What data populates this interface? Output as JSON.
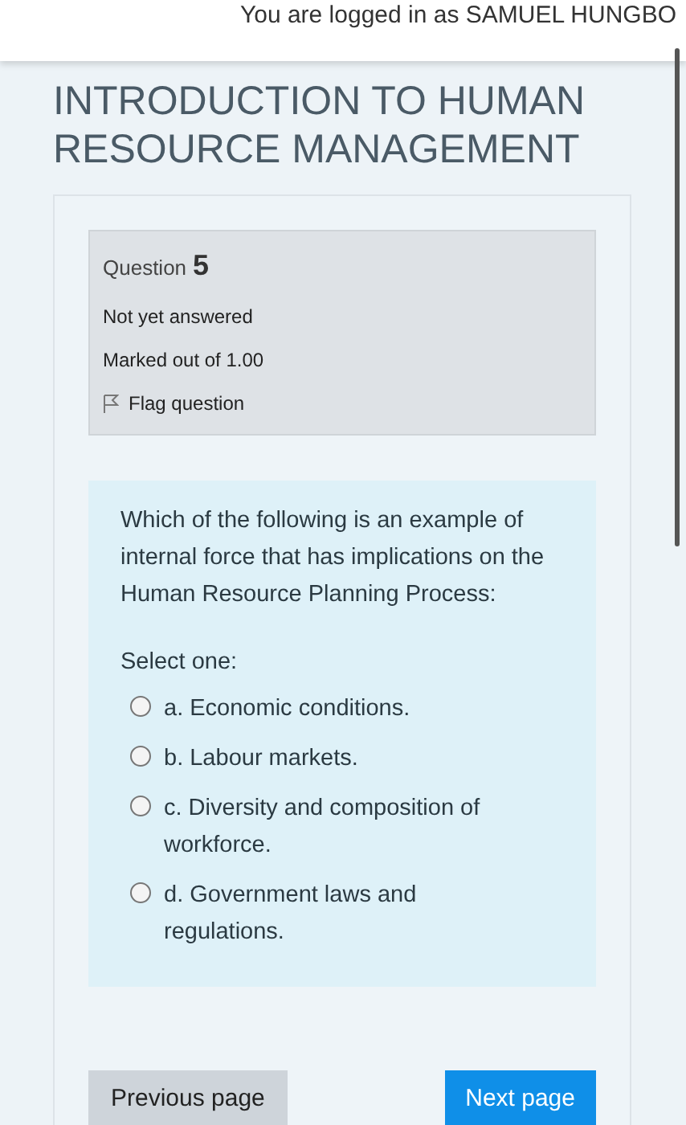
{
  "header": {
    "login_text": "You are logged in as SAMUEL HUNGBO"
  },
  "course_title": [
    "INTRODUCTION TO HUMAN",
    "RESOURCE MANAGEMENT"
  ],
  "question_info": {
    "label": "Question",
    "number": "5",
    "status": "Not yet answered",
    "marks": "Marked out of 1.00",
    "flag": "Flag question"
  },
  "question": {
    "text": "Which of the following is an example of internal force that has implications on the Human Resource Planning Process:",
    "prompt": "Select one:",
    "options": [
      {
        "label": "a. Economic conditions.",
        "selected": false
      },
      {
        "label": "b. Labour markets.",
        "selected": false
      },
      {
        "label": "c. Diversity and composition of workforce.",
        "selected": false
      },
      {
        "label": "d. Government laws and regulations.",
        "selected": false
      }
    ]
  },
  "buttons": {
    "previous": "Previous page",
    "next": "Next page"
  }
}
